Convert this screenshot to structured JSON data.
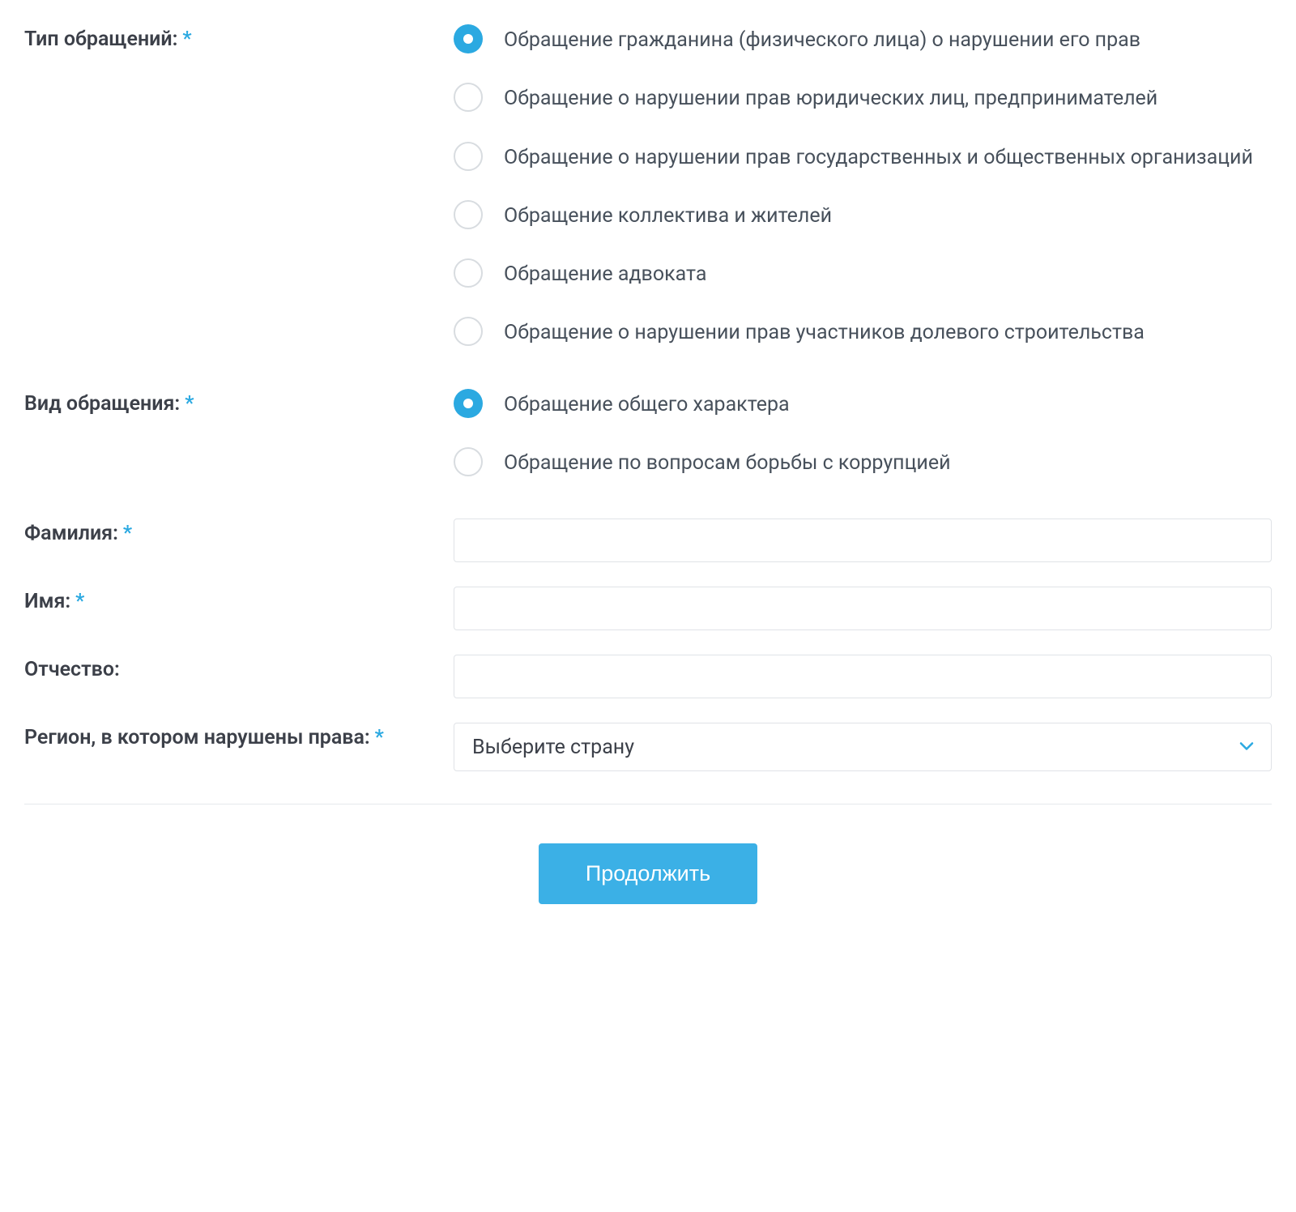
{
  "form": {
    "appeal_type": {
      "label": "Тип обращений:",
      "required": true,
      "selected": 0,
      "options": [
        "Обращение гражданина (физического лица) о нарушении его прав",
        "Обращение о нарушении прав юридических лиц, предпринимателей",
        "Обращение о нарушении прав государственных и общественных организаций",
        "Обращение коллектива и жителей",
        "Обращение адвоката",
        "Обращение о нарушении прав участников долевого строительства"
      ]
    },
    "appeal_kind": {
      "label": "Вид обращения:",
      "required": true,
      "selected": 0,
      "options": [
        "Обращение общего характера",
        "Обращение по вопросам борьбы с коррупцией"
      ]
    },
    "last_name": {
      "label": "Фамилия:",
      "required": true,
      "value": ""
    },
    "first_name": {
      "label": "Имя:",
      "required": true,
      "value": ""
    },
    "patronymic": {
      "label": "Отчество:",
      "required": false,
      "value": ""
    },
    "region": {
      "label": "Регион, в котором нарушены права:",
      "required": true,
      "placeholder": "Выберите страну"
    },
    "submit_label": "Продолжить",
    "required_marker": "*"
  }
}
